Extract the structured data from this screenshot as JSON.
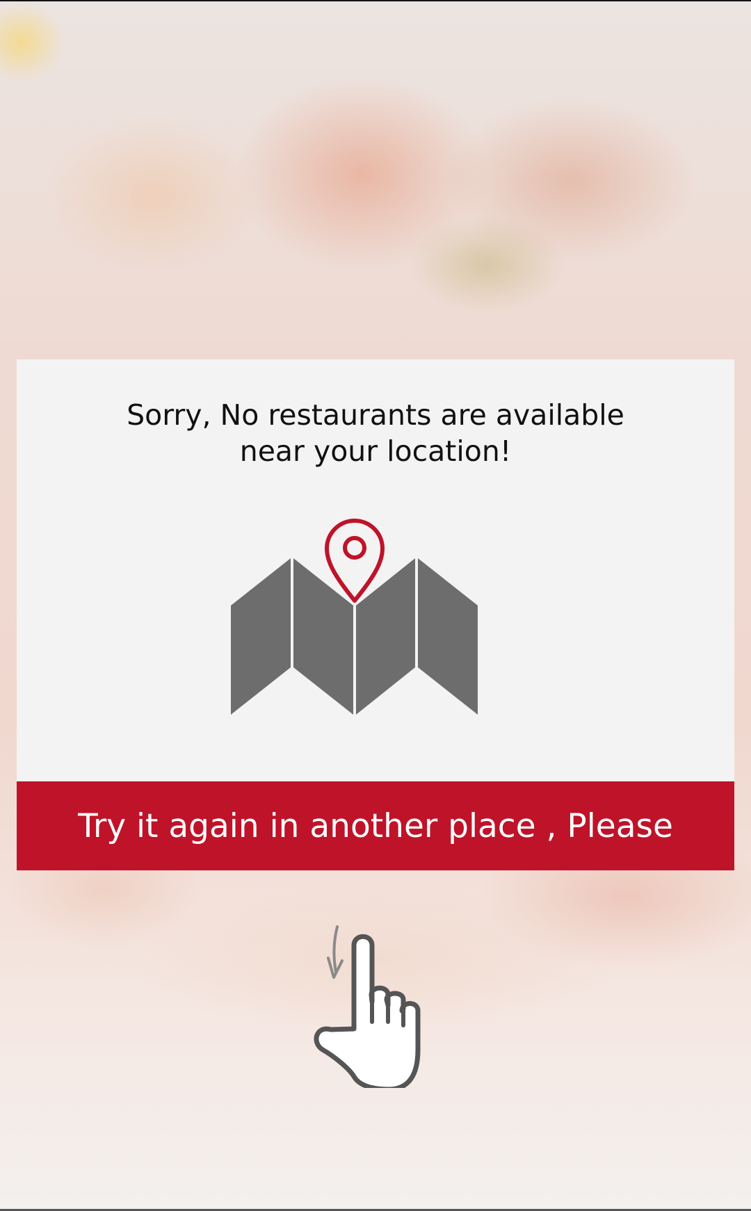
{
  "dialog": {
    "message_line1": "Sorry, No restaurants are available",
    "message_line2": "near your location!",
    "map_icon": "folded-map-with-location-pin",
    "retry_label": "Try it again in another place , Please"
  },
  "hint": {
    "icon": "hand-tap-pointer"
  },
  "colors": {
    "accent": "#bf1329",
    "card": "#f3f3f3",
    "map": "#6d6d6d"
  }
}
